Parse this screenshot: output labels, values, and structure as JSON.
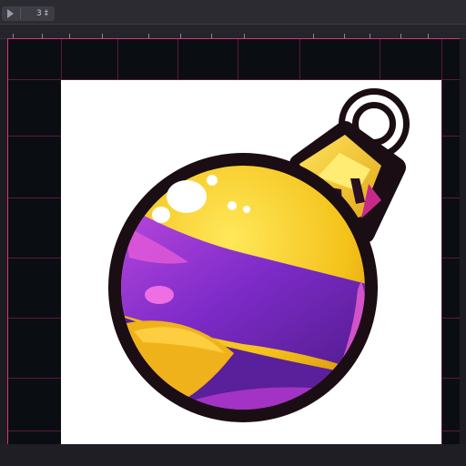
{
  "toolbar": {
    "tab_label": "3 ‡",
    "icons": [
      "play-icon"
    ]
  },
  "colors": {
    "frame_border": "#d7337f",
    "canvas_bg": "#0a0e13",
    "ornament_yellow": "#f2c21b",
    "ornament_purple": "#8a2ccf",
    "ornament_magenta": "#e040c8",
    "outline": "#1a0d14"
  }
}
